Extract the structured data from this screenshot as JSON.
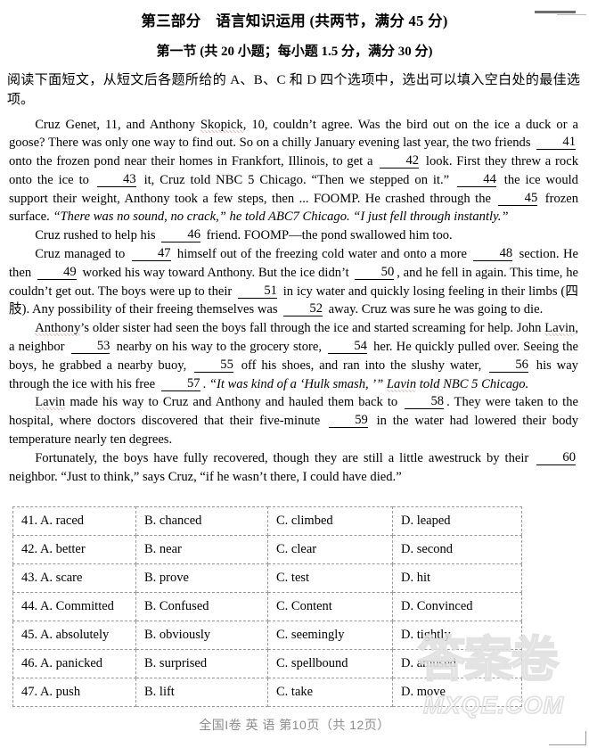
{
  "headings": {
    "part_title": "第三部分　语言知识运用 (共两节，满分 45 分)",
    "section_title": "第一节 (共 20 小题；每小题 1.5 分，满分 30 分)",
    "instruction": "阅读下面短文，从短文后各题所给的 A、B、C 和 D 四个选项中，选出可以填入空白处的最佳选项。"
  },
  "passage": {
    "p1_a": "Cruz Genet, 11, and Anthony ",
    "p1_name": "Skopick",
    "p1_b": ", 10, couldn’t agree. Was the bird out on the ice a duck or a goose? There was only one way to find out. So on a chilly January evening last year, the two friends ",
    "p1_blank1": "41",
    "p1_c": " onto the frozen pond near their homes in Frankfort, Illinois, to get a ",
    "p1_blank2": "42",
    "p1_d": " look. First they threw a rock onto the ice to ",
    "p1_blank3": "43",
    "p1_e": " it, Cruz told NBC 5 Chicago. “Then we stepped on it.” ",
    "p1_blank4": "44",
    "p1_f": " the ice would support their weight, Anthony took a few steps, then ... FOOMP. He crashed through the ",
    "p1_blank5": "45",
    "p1_g": " frozen surface. ",
    "p1_quote": "“There was no sound, no crack,” he told ABC7 Chicago. “I just fell through instantly.”",
    "p2_a": "Cruz rushed to help his ",
    "p2_blank": "46",
    "p2_b": " friend. FOOMP—the pond swallowed him too.",
    "p3_a": "Cruz managed to ",
    "p3_blank1": "47",
    "p3_b": " himself out of the freezing cold water and onto a more ",
    "p3_blank2": "48",
    "p3_c": " section. He then ",
    "p3_blank3": "49",
    "p3_d": " worked his way toward Anthony. But the ice didn’t ",
    "p3_blank4": "50",
    "p3_e": ", and he fell in again. This time, he couldn’t get out. The boys were up to their ",
    "p3_blank5": "51",
    "p3_f": " in icy water and quickly losing feeling in their limbs (四肢). Any possibility of their freeing themselves was ",
    "p3_blank6": "52",
    "p3_g": " away. Cruz was sure he was going to die.",
    "p4_a": "",
    "p4_name1": "Anthony",
    "p4_b": "’s older sister had seen the boys fall through the ice and started screaming for help. John ",
    "p4_name2": "Lavin",
    "p4_c": ", a neighbor ",
    "p4_blank1": "53",
    "p4_d": " nearby on his way to the grocery store, ",
    "p4_blank2": "54",
    "p4_e": " her. He quickly pulled over. Seeing the boys, he grabbed a nearby buoy, ",
    "p4_blank3": "55",
    "p4_f": " off his shoes, and ran into the slushy water, ",
    "p4_blank4": "56",
    "p4_g": " his way through the ice with his free ",
    "p4_blank5": "57",
    "p4_h": ". ",
    "p4_quote1": "“It was kind of a ‘Hulk smash, ’” ",
    "p4_quote_name": "Lavin",
    "p4_quote2": " told NBC 5 Chicago.",
    "p5_name": "Lavin",
    "p5_a": " made his way to Cruz and Anthony and hauled them back to ",
    "p5_blank1": "58",
    "p5_b": ". They were taken to the hospital, where doctors discovered that their five-minute ",
    "p5_blank2": "59",
    "p5_c": " in the water had lowered their body temperature nearly ten degrees.",
    "p6_a": "Fortunately, the boys have fully recovered, though they are still a little awestruck by their ",
    "p6_blank": "60",
    "p6_b": " neighbor. “Just to think,” says Cruz, “if he wasn’t there, I could have died.”"
  },
  "choices_table": {
    "rows": [
      {
        "a": "41. A. raced",
        "b": "B. chanced",
        "c": "C. climbed",
        "d": "D. leaped"
      },
      {
        "a": "42. A. better",
        "b": "B. near",
        "c": "C. clear",
        "d": "D. second"
      },
      {
        "a": "43. A. scare",
        "b": "B. prove",
        "c": "C. test",
        "d": "D. hit"
      },
      {
        "a": "44. A. Committed",
        "b": "B. Confused",
        "c": "C. Content",
        "d": "D. Convinced"
      },
      {
        "a": "45. A. absolutely",
        "b": "B. obviously",
        "c": "C. seemingly",
        "d": "D. tightly"
      },
      {
        "a": "46. A. panicked",
        "b": "B. surprised",
        "c": "C. spellbound",
        "d": "D. amused"
      },
      {
        "a": "47. A. push",
        "b": "B. lift",
        "c": "C. take",
        "d": "D. move"
      }
    ]
  },
  "footer": {
    "text": "全国I卷 英 语 第10页（共 12页）"
  },
  "watermark": {
    "chinese": "答案卷",
    "site": "MXQE.COM"
  }
}
